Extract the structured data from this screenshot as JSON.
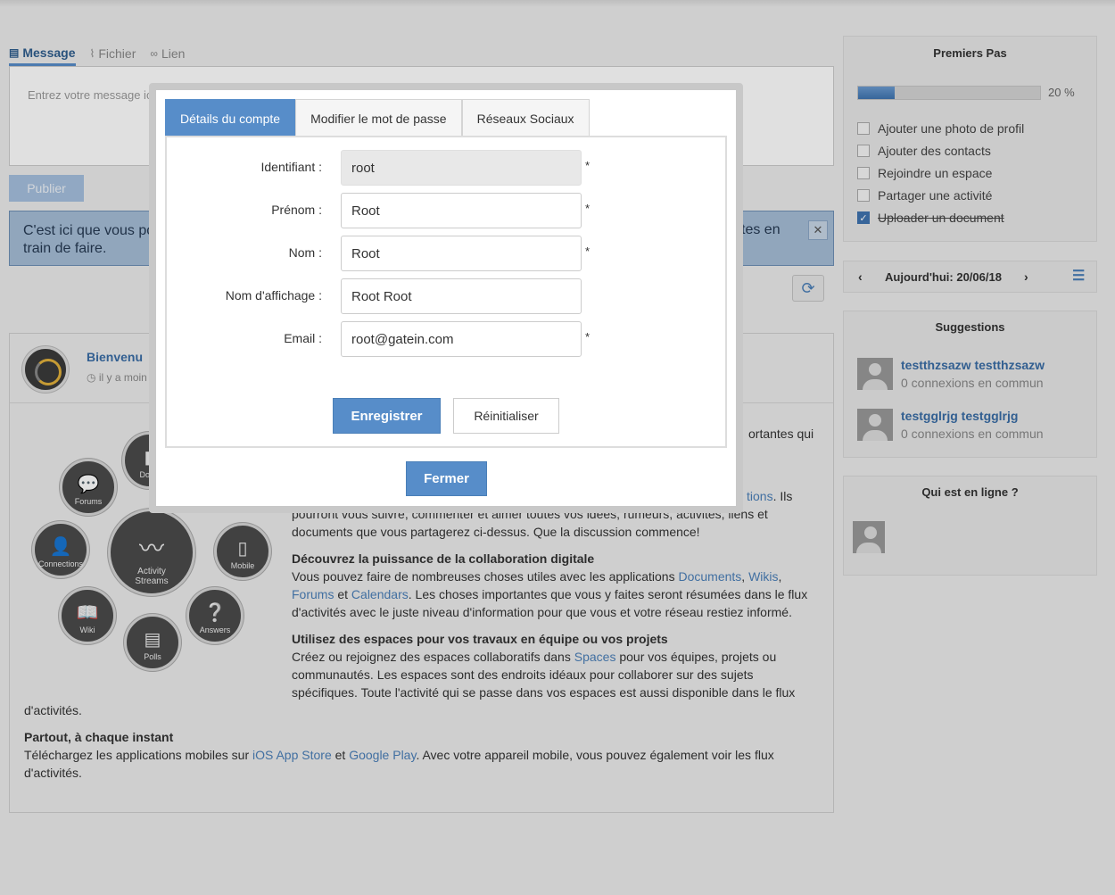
{
  "composer": {
    "tabs": [
      {
        "label": "Message",
        "icon": "document-icon"
      },
      {
        "label": "Fichier",
        "icon": "paperclip-icon"
      },
      {
        "label": "Lien",
        "icon": "link-icon"
      }
    ],
    "placeholder": "Entrez votre message ic",
    "publish_label": "Publier"
  },
  "tip": {
    "line1": "C'est ici que vous po",
    "line2": "train de faire.",
    "line_right": "tes en"
  },
  "activity": {
    "title": "Bienvenu",
    "time": "il y a moin",
    "intro_tail": "ortantes qui",
    "p1_frag1": "tions",
    "p1_frag2": ". Ils",
    "p1_line2": "pourront vous suivre, commenter et aimer toutes vos idées, rumeurs, activités, liens et",
    "p1_line3": "documents que vous partagerez ci-dessus. Que la discussion commence!",
    "h2": "Découvrez la puissance de la collaboration digitale",
    "p2_a": "Vous pouvez faire de nombreuses choses utiles avec les applications ",
    "p2_link1": "Documents",
    "p2_sep1": ", ",
    "p2_link2": "Wikis",
    "p2_sep2": ",",
    "p2_link3": "Forums",
    "p2_et": " et ",
    "p2_link4": "Calendars",
    "p2_b": ". Les choses importantes que vous y faites seront résumées dans le flux",
    "p2_c": "d'activités avec le juste niveau d'information pour que vous et votre réseau restiez informé.",
    "h3": "Utilisez des espaces pour vos travaux en équipe ou vos projets",
    "p3_a": "Créez ou rejoignez des espaces collaboratifs dans ",
    "p3_link": "Spaces",
    "p3_b": " pour vos équipes, projets ou",
    "p3_c": "communautés. Les espaces sont des endroits idéaux pour collaborer sur des sujets",
    "p3_d": "spécifiques. Toute l'activité qui se passe dans vos espaces est aussi disponible dans le flux",
    "p3_e": "d'activités.",
    "h4": "Partout, à chaque instant",
    "p4_a": "Téléchargez les applications mobiles sur ",
    "p4_link1": "iOS App Store",
    "p4_et": " et ",
    "p4_link2": "Google Play",
    "p4_b": ". Avec votre appareil mobile, vous pouvez également voir les flux",
    "p4_c": "d'activités.",
    "bubbles": {
      "forums": "Forums",
      "docs": "Docu",
      "connections": "Connections",
      "streams1": "Activity",
      "streams2": "Streams",
      "mobile": "Mobile",
      "wiki": "Wiki",
      "polls": "Polls",
      "answers": "Answers"
    }
  },
  "premiers_pas": {
    "title": "Premiers Pas",
    "progress_percent": 20,
    "progress_label": "20 %",
    "items": [
      {
        "label": "Ajouter une photo de profil",
        "checked": false
      },
      {
        "label": "Ajouter des contacts",
        "checked": false
      },
      {
        "label": "Rejoindre un espace",
        "checked": false
      },
      {
        "label": "Partager une activité",
        "checked": false
      },
      {
        "label": "Uploader un document",
        "checked": true
      }
    ]
  },
  "calendar": {
    "date_label": "Aujourd'hui: 20/06/18",
    "prev": "‹",
    "next": "›"
  },
  "suggestions": {
    "title": "Suggestions",
    "people": [
      {
        "name": "testthzsazw testthzsazw",
        "common": "0 connexions en commun"
      },
      {
        "name": "testgglrjg testgglrjg",
        "common": "0 connexions en commun"
      }
    ]
  },
  "online": {
    "title": "Qui est en ligne ?"
  },
  "modal": {
    "tabs": [
      "Détails du compte",
      "Modifier le mot de passe",
      "Réseaux Sociaux"
    ],
    "fields": [
      {
        "label": "Identifiant :",
        "value": "root",
        "required": "*"
      },
      {
        "label": "Prénom :",
        "value": "Root",
        "required": "*"
      },
      {
        "label": "Nom :",
        "value": "Root",
        "required": "*"
      },
      {
        "label": "Nom d'affichage :",
        "value": "Root Root",
        "required": ""
      },
      {
        "label": "Email :",
        "value": "root@gatein.com",
        "required": "*"
      }
    ],
    "save_label": "Enregistrer",
    "reset_label": "Réinitialiser",
    "close_label": "Fermer"
  },
  "colors": {
    "accent": "#578dc9",
    "link": "#4a7fb8"
  }
}
